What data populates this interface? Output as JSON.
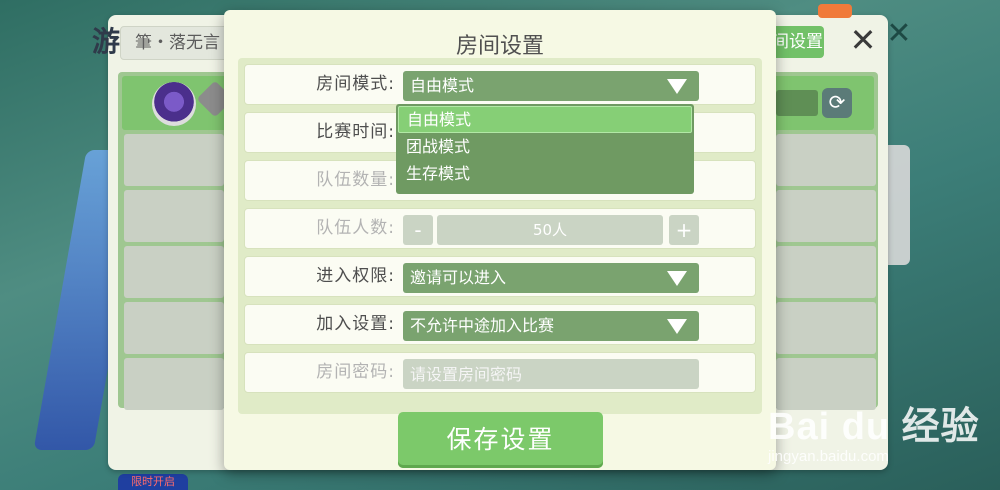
{
  "background": {
    "title_char": "游",
    "room_name_value": "筆・落无言",
    "settings_button": "间设置",
    "bottom_badge": "限时开启"
  },
  "modal": {
    "title": "房间设置",
    "rows": [
      {
        "label": "房间模式:",
        "value": "自由模式"
      },
      {
        "label": "比赛时间:"
      },
      {
        "label": "队伍数量:"
      },
      {
        "label": "队伍人数:",
        "value": "50人",
        "minus": "-",
        "plus": "+"
      },
      {
        "label": "进入权限:",
        "value": "邀请可以进入"
      },
      {
        "label": "加入设置:",
        "value": "不允许中途加入比赛"
      },
      {
        "label": "房间密码:",
        "placeholder": "请设置房间密码"
      }
    ],
    "dropdown_options": [
      "自由模式",
      "团战模式",
      "生存模式"
    ],
    "selected_option": "自由模式",
    "save_button": "保存设置"
  },
  "watermark": {
    "brand": "Bai  du 经验",
    "url": "jingyan.baidu.com"
  },
  "colors": {
    "accent_green": "#7cc96a",
    "select_green": "#7aa36f",
    "modal_bg": "#f6f9e4"
  }
}
